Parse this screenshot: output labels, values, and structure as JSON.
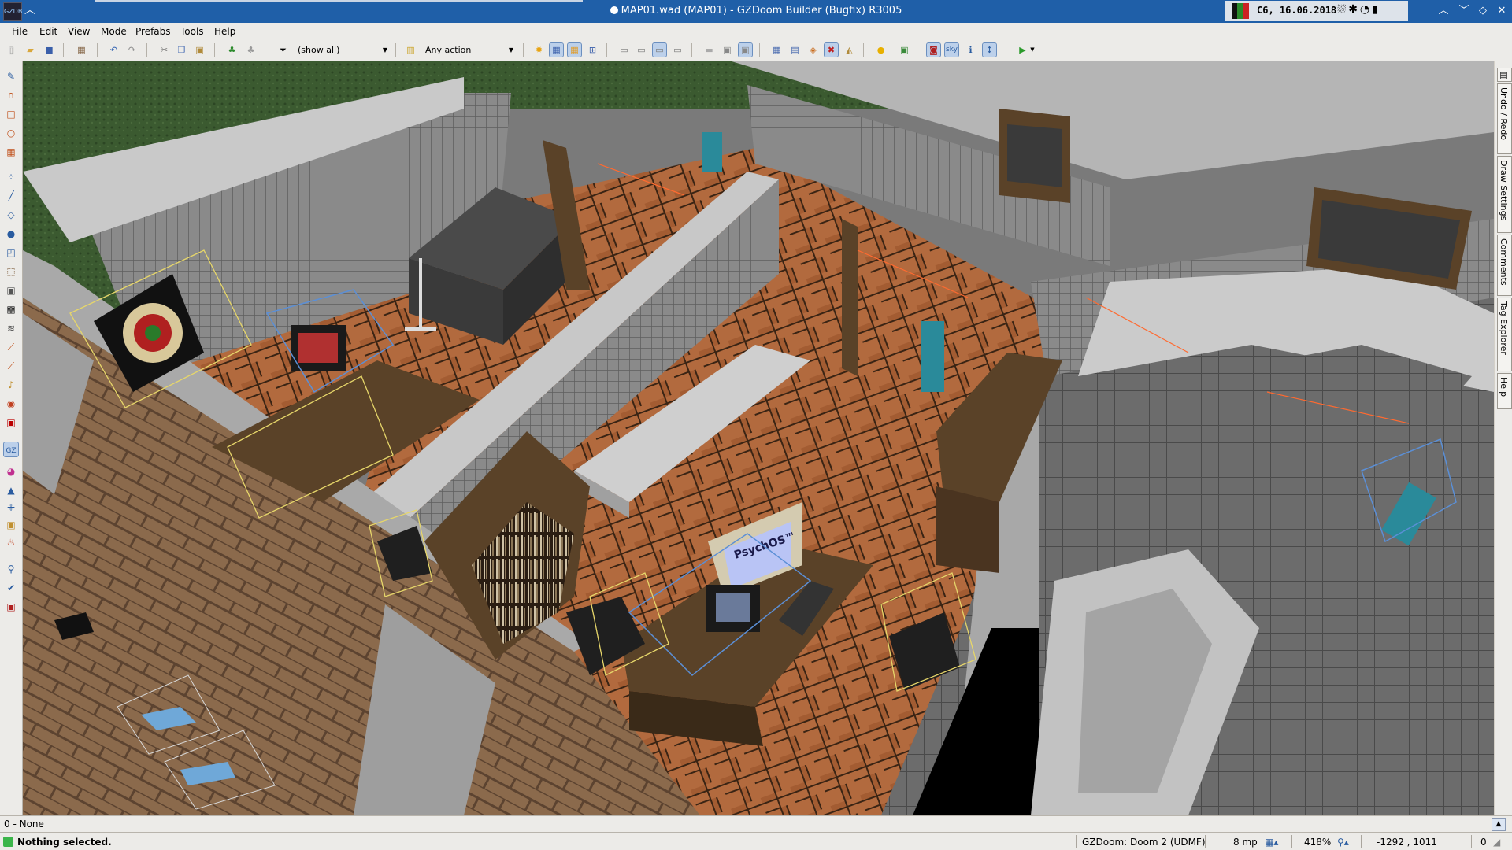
{
  "window": {
    "title": "MAP01.wad (MAP01) - GZDoom Builder (Bugfix) R3005",
    "app_icon": "GZDB"
  },
  "tray": {
    "clock": "C6, 16.06.2018",
    "flag_colors": [
      "#111111",
      "#2a8a2a",
      "#cc2222"
    ],
    "glyphs": "⛆✱◔▮"
  },
  "menu": {
    "items": [
      "File",
      "Edit",
      "View",
      "Mode",
      "Prefabs",
      "Tools",
      "Help"
    ]
  },
  "toolbar": {
    "filter_value": "(show all)",
    "action_value": "Any action"
  },
  "dock_tabs": [
    "Undo / Redo",
    "Draw Settings",
    "Comments",
    "Tag Explorer",
    "Help"
  ],
  "info_panel": {
    "text": "0 - None"
  },
  "status": {
    "message": "Nothing selected.",
    "game_config": "GZDoom: Doom 2 (UDMF)",
    "grid": "8 mp",
    "zoom": "418%",
    "coords": "-1292 , 1011",
    "extra": "0"
  },
  "scene": {
    "monitor_text": "PsychOS™",
    "colors": {
      "wall": "#9b9b9b",
      "wall_top": "#bdbdbd",
      "brick": "#8b6a4c",
      "floor_tile": "#6c6c6c",
      "parquet": "#b26a3e",
      "grass": "#3b5a30",
      "wood": "#5a4228",
      "selection": "#e6d66a",
      "bbox": "#5b8fd6"
    }
  }
}
